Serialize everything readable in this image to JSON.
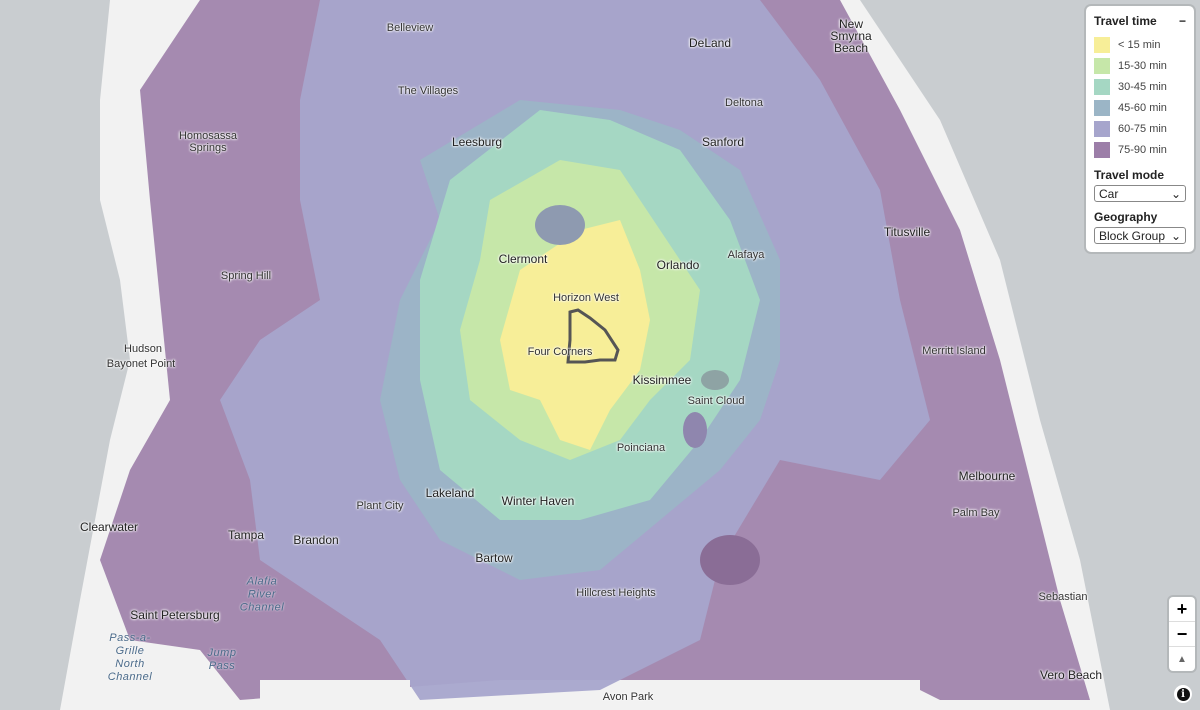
{
  "legend": {
    "title": "Travel time",
    "collapse_label": "−",
    "bins": [
      {
        "label": "< 15 min",
        "color": "#f7ee98"
      },
      {
        "label": "15-30 min",
        "color": "#c6e7a9"
      },
      {
        "label": "30-45 min",
        "color": "#a5d7c3"
      },
      {
        "label": "45-60 min",
        "color": "#9bb5c6"
      },
      {
        "label": "60-75 min",
        "color": "#a6a5cc"
      },
      {
        "label": "75-90 min",
        "color": "#9c7ea8"
      }
    ],
    "travel_mode_label": "Travel mode",
    "travel_mode_value": "Car",
    "geography_label": "Geography",
    "geography_value": "Block Group"
  },
  "controls": {
    "zoom_in": "+",
    "zoom_out": "−",
    "compass": "▲",
    "info": "i"
  },
  "places": [
    "Belleview",
    "DeLand",
    "New Smyrna Beach",
    "The Villages",
    "Deltona",
    "Homosassa Springs",
    "Leesburg",
    "Sanford",
    "Titusville",
    "Clermont",
    "Orlando",
    "Alafaya",
    "Horizon West",
    "Spring Hill",
    "Four Corners",
    "Hudson",
    "Bayonet Point",
    "Kissimmee",
    "Saint Cloud",
    "Merritt Island",
    "Poinciana",
    "Melbourne",
    "Plant City",
    "Lakeland",
    "Winter Haven",
    "Clearwater",
    "Tampa",
    "Brandon",
    "Palm Bay",
    "Bartow",
    "Saint Petersburg",
    "Hillcrest Heights",
    "Sebastian",
    "Avon Park",
    "Vero Beach"
  ],
  "water": [
    "Alafia River Channel",
    "Pass-a-Grille North Channel",
    "Jump Pass"
  ]
}
